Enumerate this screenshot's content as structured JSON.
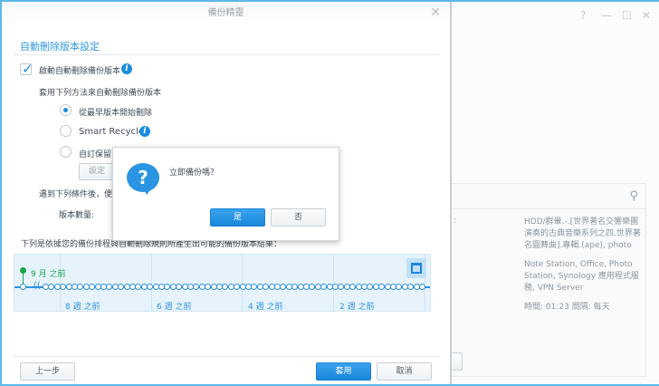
{
  "dialog": {
    "title": "備份精靈",
    "section_title": "自動刪除版本設定",
    "enable_label": "啟動自動刪除備份版本",
    "enable_checked": true,
    "method_label": "套用下列方法來自動刪除備份版本",
    "options": [
      {
        "label": "從最早版本開始刪除",
        "selected": true
      },
      {
        "label": "Smart Recycle",
        "selected": false
      },
      {
        "label": "自訂保留",
        "selected": false
      }
    ],
    "settings_button": "設定",
    "condition_label": "遇到下列條件後，便",
    "version_count_label": "版本數量:",
    "preview_caption": "下列是依據您的備份排程與自動刪除規則所產生出可能的備份版本結果：",
    "timeline": {
      "oldest_label": "9 月 之前",
      "week_labels": [
        "8 週 之前",
        "6 週 之前",
        "4 週 之前",
        "2 週 之前"
      ],
      "version_count": 66
    },
    "back_button": "上一步",
    "apply_button": "套用",
    "cancel_button": "取消",
    "close": "✕"
  },
  "confirm": {
    "message": "立即備份嗎？",
    "yes": "是",
    "no": "否"
  },
  "background_window": {
    "controls": [
      "?",
      "—",
      "☐",
      "✕"
    ],
    "colon": ":",
    "destination": "HDD/群暈.-.[世界著名交響樂團演奏的古典音樂系列之四.世界著名圓舞曲].專輯.(ape), photo",
    "apps": "Note Station, Office, Photo Station, Synology 應用程式服務, VPN Server",
    "schedule": "時間: 01:23 間隔: 每天"
  },
  "colors": {
    "accent": "#1a8de0",
    "green": "#1aa34a"
  }
}
